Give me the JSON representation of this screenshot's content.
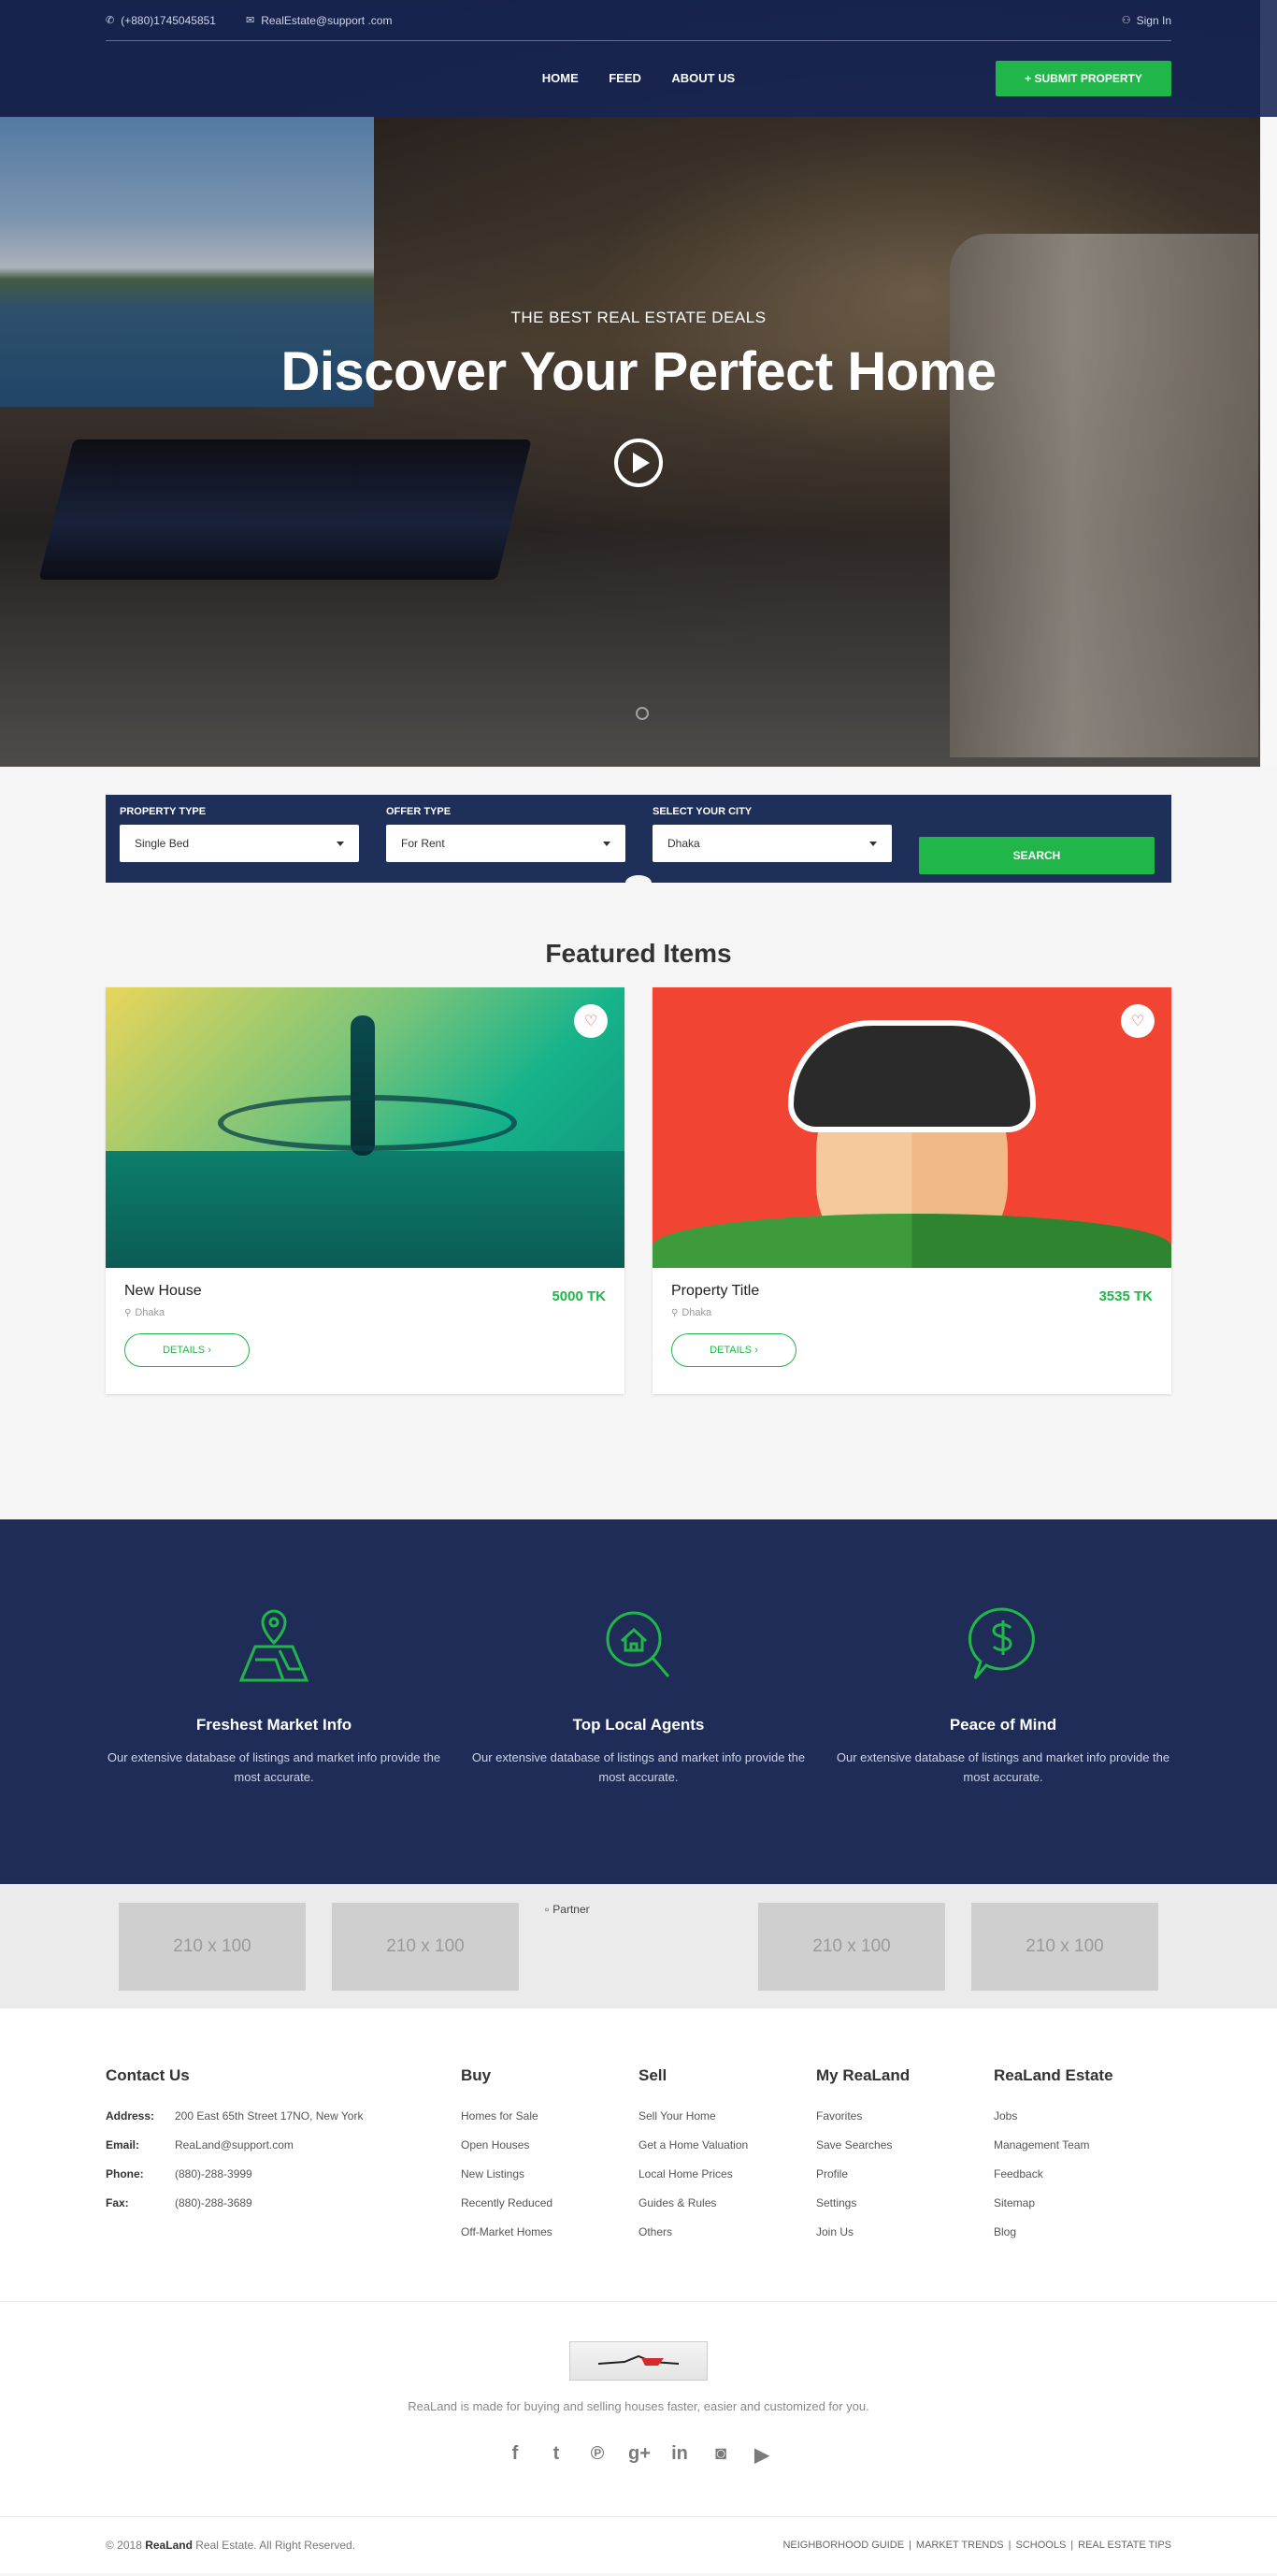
{
  "topbar": {
    "phone": "(+880)1745045851",
    "email": "RealEstate@support .com",
    "signin": "Sign In"
  },
  "nav": {
    "items": [
      "HOME",
      "FEED",
      "ABOUT US"
    ],
    "submit_label": "+ SUBMIT PROPERTY"
  },
  "hero": {
    "subtitle": "THE BEST REAL ESTATE DEALS",
    "title": "Discover Your Perfect Home"
  },
  "search": {
    "fields": [
      {
        "label": "PROPERTY TYPE",
        "value": "Single Bed"
      },
      {
        "label": "OFFER TYPE",
        "value": "For Rent"
      },
      {
        "label": "SELECT YOUR CITY",
        "value": "Dhaka"
      }
    ],
    "button": "SEARCH"
  },
  "featured": {
    "title": "Featured Items",
    "cards": [
      {
        "title": "New House",
        "location": "Dhaka",
        "price": "5000 TK",
        "button": "DETAILS ›"
      },
      {
        "title": "Property Title",
        "location": "Dhaka",
        "price": "3535 TK",
        "button": "DETAILS ›"
      }
    ]
  },
  "features": {
    "items": [
      {
        "icon": "map-pin-icon",
        "title": "Freshest Market Info",
        "desc": "Our extensive database of listings and market info provide the most accurate."
      },
      {
        "icon": "home-search-icon",
        "title": "Top Local Agents",
        "desc": "Our extensive database of listings and market info provide the most accurate."
      },
      {
        "icon": "dollar-chat-icon",
        "title": "Peace of Mind",
        "desc": "Our extensive database of listings and market info provide the most accurate."
      }
    ]
  },
  "partners": {
    "placeholder": "210 x 100",
    "broken_alt": "Partner"
  },
  "footer": {
    "contact": {
      "title": "Contact Us",
      "rows": [
        {
          "label": "Address:",
          "value": "200 East 65th Street 17NO, New York"
        },
        {
          "label": "Email:",
          "value": "ReaLand@support.com"
        },
        {
          "label": "Phone:",
          "value": "(880)-288-3999"
        },
        {
          "label": "Fax:",
          "value": "(880)-288-3689"
        }
      ]
    },
    "columns": [
      {
        "title": "Buy",
        "links": [
          "Homes for Sale",
          "Open Houses",
          "New Listings",
          "Recently Reduced",
          "Off-Market Homes"
        ]
      },
      {
        "title": "Sell",
        "links": [
          "Sell Your Home",
          "Get a Home Valuation",
          "Local Home Prices",
          "Guides & Rules",
          "Others"
        ]
      },
      {
        "title": "My ReaLand",
        "links": [
          "Favorites",
          "Save Searches",
          "Profile",
          "Settings",
          "Join Us"
        ]
      },
      {
        "title": "ReaLand Estate",
        "links": [
          "Jobs",
          "Management Team",
          "Feedback",
          "Sitemap",
          "Blog"
        ]
      }
    ],
    "brand_text": "ReaLand is made for buying and selling houses faster, easier and customized for you.",
    "social_icons": [
      "facebook-icon",
      "twitter-icon",
      "pinterest-icon",
      "google-plus-icon",
      "linkedin-icon",
      "instagram-icon",
      "youtube-icon"
    ],
    "copyright_prefix": "© 2018",
    "copyright_brand": "ReaLand",
    "copyright_suffix": "Real Estate. All Right Reserved.",
    "bottom_links": [
      "NEIGHBORHOOD GUIDE",
      "MARKET TRENDS",
      "SCHOOLS",
      "REAL ESTATE TIPS"
    ]
  },
  "colors": {
    "navy": "#1e2c57",
    "green": "#21b64a",
    "accent_red": "#e8534a"
  }
}
